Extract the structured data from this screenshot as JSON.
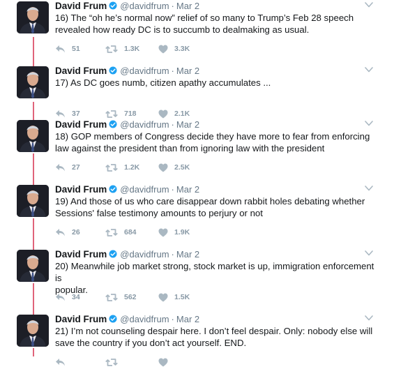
{
  "author": {
    "name": "David Frum",
    "handle": "@davidfrum",
    "verified_icon": "verified-badge-icon",
    "verified_color": "#1da1f2"
  },
  "colors": {
    "thread_line": "#e0647a",
    "muted": "#8899a6"
  },
  "tweets": [
    {
      "date": "Mar 2",
      "text": "16) The “oh he’s normal now” relief of so many to Trump’s Feb 28 speech\nrevealed how ready DC is to succumb to dealmaking as usual.",
      "replies": "51",
      "retweets": "1.3K",
      "likes": "3.3K"
    },
    {
      "date": "Mar 2",
      "text": "17) As DC goes numb, citizen apathy accumulates ...",
      "replies": "37",
      "retweets": "718",
      "likes": "2.1K"
    },
    {
      "date": "Mar 2",
      "text": "18) GOP members of Congress decide they have more to fear from enforcing\nlaw against the president than from ignoring law with the president",
      "replies": "27",
      "retweets": "1.2K",
      "likes": "2.5K"
    },
    {
      "date": "Mar 2",
      "text": "19) And those of us who care disappear down rabbit holes debating whether\nSessions' false testimony amounts to perjury or not",
      "replies": "26",
      "retweets": "684",
      "likes": "1.9K"
    },
    {
      "date": "Mar 2",
      "text": "20) Meanwhile job market strong, stock market is up, immigration enforcement is\npopular.",
      "replies": "34",
      "retweets": "562",
      "likes": "1.5K"
    },
    {
      "date": "Mar 2",
      "text": "21) I’m not counseling despair here. I don’t feel despair. Only: nobody else will\nsave the country if you don’t act yourself. END.",
      "replies": "",
      "retweets": "",
      "likes": ""
    }
  ]
}
